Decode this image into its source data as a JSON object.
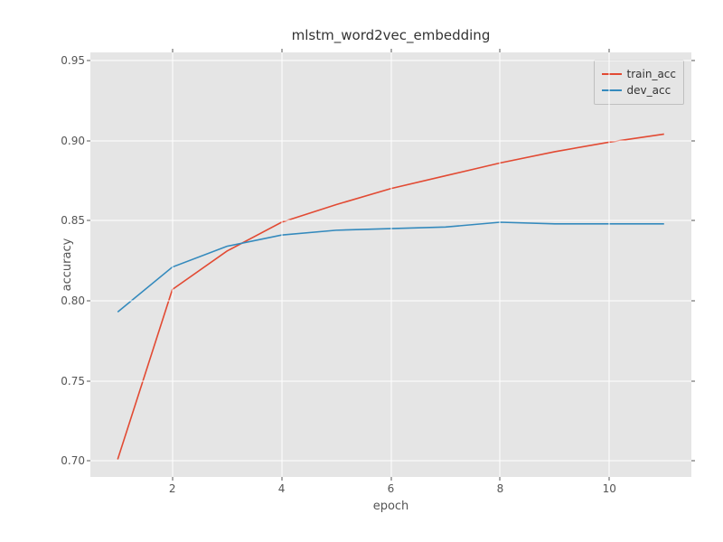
{
  "chart_data": {
    "type": "line",
    "title": "mlstm_word2vec_embedding",
    "xlabel": "epoch",
    "ylabel": "accuracy",
    "xlim": [
      0.5,
      11.5
    ],
    "ylim": [
      0.69,
      0.955
    ],
    "xticks": [
      2,
      4,
      6,
      8,
      10
    ],
    "yticks": [
      0.7,
      0.75,
      0.8,
      0.85,
      0.9,
      0.95
    ],
    "legend_position": "upper right",
    "series": [
      {
        "name": "train_acc",
        "color": "#e24a33",
        "x": [
          1,
          2,
          3,
          4,
          5,
          6,
          7,
          8,
          9,
          10,
          11
        ],
        "y": [
          0.701,
          0.807,
          0.831,
          0.849,
          0.86,
          0.87,
          0.878,
          0.886,
          0.893,
          0.899,
          0.904
        ]
      },
      {
        "name": "dev_acc",
        "color": "#348abd",
        "x": [
          1,
          2,
          3,
          4,
          5,
          6,
          7,
          8,
          9,
          10,
          11
        ],
        "y": [
          0.793,
          0.821,
          0.834,
          0.841,
          0.844,
          0.845,
          0.846,
          0.849,
          0.848,
          0.848,
          0.848
        ]
      }
    ]
  },
  "layout": {
    "axes_left": 100,
    "axes_top": 58,
    "axes_width": 665,
    "axes_height": 470
  }
}
